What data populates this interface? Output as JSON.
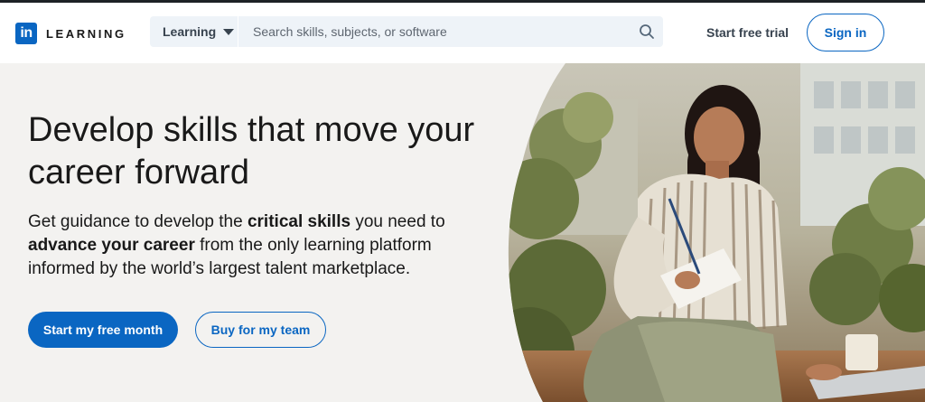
{
  "header": {
    "logo_mark": "in",
    "logo_word": "LEARNING",
    "search_category": "Learning",
    "search_placeholder": "Search skills, subjects, or software",
    "start_trial": "Start free trial",
    "sign_in": "Sign in"
  },
  "hero": {
    "title": "Develop skills that move your career forward",
    "sub_1": "Get guidance to develop the ",
    "sub_2": "critical skills",
    "sub_3": " you need to ",
    "sub_4": "advance your career",
    "sub_5": " from the only learning platform informed by the world’s largest talent marketplace.",
    "primary_button": "Start my free month",
    "secondary_button": "Buy for my team"
  },
  "colors": {
    "brand": "#0a66c2",
    "hero_bg": "#f3f2f0",
    "search_bg": "#eef3f8"
  },
  "icons": {
    "search": "search-icon",
    "dropdown": "caret-down-icon"
  }
}
